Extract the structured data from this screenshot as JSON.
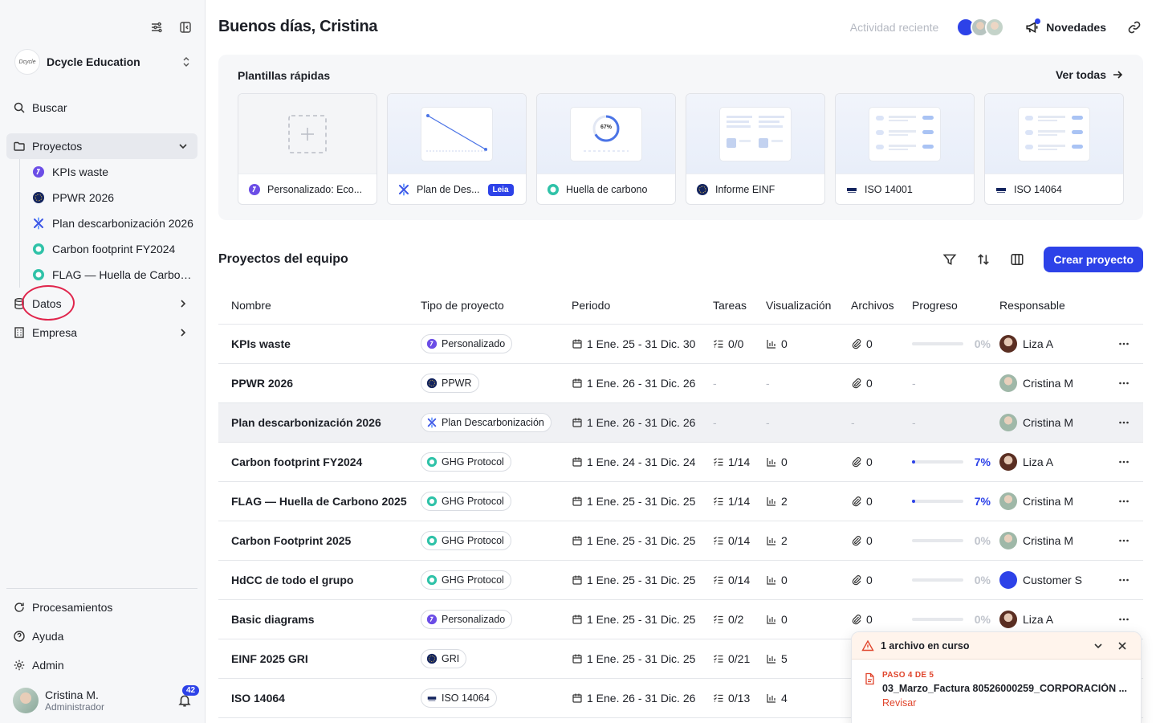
{
  "sidebar": {
    "org_logo_text": "Dcycle",
    "org_name": "Dcycle Education",
    "search_label": "Buscar",
    "projects_label": "Proyectos",
    "project_items": [
      {
        "label": "KPIs waste",
        "icon": "dcycle-icon"
      },
      {
        "label": "PPWR 2026",
        "icon": "eu-icon"
      },
      {
        "label": "Plan descarbonización 2026",
        "icon": "decarb-icon"
      },
      {
        "label": "Carbon footprint FY2024",
        "icon": "ghg-icon"
      },
      {
        "label": "FLAG — Huella de Carbono 2025",
        "icon": "ghg-icon"
      }
    ],
    "data_label": "Datos",
    "company_label": "Empresa",
    "processing_label": "Procesamientos",
    "help_label": "Ayuda",
    "admin_label": "Admin",
    "user_name": "Cristina M.",
    "user_role": "Administrador",
    "notifications_count": "42"
  },
  "header": {
    "greeting": "Buenos días, Cristina",
    "recent_activity": "Actividad reciente",
    "news_label": "Novedades"
  },
  "templates": {
    "title": "Plantillas rápidas",
    "see_all": "Ver todas",
    "items": [
      {
        "label": "Personalizado: Eco...",
        "icon": "dcycle-icon"
      },
      {
        "label": "Plan de Des...",
        "icon": "decarb-icon",
        "badge": "Leia"
      },
      {
        "label": "Huella de carbono",
        "icon": "ghg-icon",
        "preview_value": "67%"
      },
      {
        "label": "Informe EINF",
        "icon": "eu-icon"
      },
      {
        "label": "ISO 14001",
        "icon": "iso-icon"
      },
      {
        "label": "ISO 14064",
        "icon": "iso-icon"
      }
    ]
  },
  "team": {
    "title": "Proyectos del equipo",
    "create_label": "Crear proyecto",
    "columns": [
      "Nombre",
      "Tipo de proyecto",
      "Periodo",
      "Tareas",
      "Visualización",
      "Archivos",
      "Progreso",
      "Responsable"
    ],
    "rows": [
      {
        "name": "KPIs waste",
        "type": "Personalizado",
        "type_icon": "dcycle-icon",
        "period": "1 Ene. 25 - 31 Dic. 30",
        "tasks": "0/0",
        "vis": "0",
        "files": "0",
        "progress": 0,
        "progress_label": "0%",
        "owner": "Liza A",
        "owner_avatar": "liza"
      },
      {
        "name": "PPWR 2026",
        "type": "PPWR",
        "type_icon": "eu-icon",
        "period": "1 Ene. 26 - 31 Dic. 26",
        "tasks": "-",
        "vis": "-",
        "files": "0",
        "progress": null,
        "progress_label": "-",
        "owner": "Cristina M",
        "owner_avatar": "cris"
      },
      {
        "name": "Plan descarbonización 2026",
        "type": "Plan Descarbonización",
        "type_icon": "decarb-icon",
        "period": "1 Ene. 26 - 31 Dic. 26",
        "tasks": "-",
        "vis": "-",
        "files": "-",
        "progress": null,
        "progress_label": "-",
        "owner": "Cristina M",
        "owner_avatar": "cris",
        "highlight": true
      },
      {
        "name": "Carbon footprint FY2024",
        "type": "GHG Protocol",
        "type_icon": "ghg-icon",
        "period": "1 Ene. 24 - 31 Dic. 24",
        "tasks": "1/14",
        "vis": "0",
        "files": "0",
        "progress": 7,
        "progress_label": "7%",
        "owner": "Liza A",
        "owner_avatar": "liza"
      },
      {
        "name": "FLAG — Huella de Carbono 2025",
        "type": "GHG Protocol",
        "type_icon": "ghg-icon",
        "period": "1 Ene. 25 - 31 Dic. 25",
        "tasks": "1/14",
        "vis": "2",
        "files": "0",
        "progress": 7,
        "progress_label": "7%",
        "owner": "Cristina M",
        "owner_avatar": "cris"
      },
      {
        "name": "Carbon Footprint 2025",
        "type": "GHG Protocol",
        "type_icon": "ghg-icon",
        "period": "1 Ene. 25 - 31 Dic. 25",
        "tasks": "0/14",
        "vis": "2",
        "files": "0",
        "progress": 0,
        "progress_label": "0%",
        "owner": "Cristina M",
        "owner_avatar": "cris"
      },
      {
        "name": "HdCC de todo el grupo",
        "type": "GHG Protocol",
        "type_icon": "ghg-icon",
        "period": "1 Ene. 25 - 31 Dic. 25",
        "tasks": "0/14",
        "vis": "0",
        "files": "0",
        "progress": 0,
        "progress_label": "0%",
        "owner": "Customer S",
        "owner_avatar": "cust"
      },
      {
        "name": "Basic diagrams",
        "type": "Personalizado",
        "type_icon": "dcycle-icon",
        "period": "1 Ene. 25 - 31 Dic. 25",
        "tasks": "0/2",
        "vis": "0",
        "files": "0",
        "progress": 0,
        "progress_label": "0%",
        "owner": "Liza A",
        "owner_avatar": "liza"
      },
      {
        "name": "EINF 2025 GRI",
        "type": "GRI",
        "type_icon": "eu-icon",
        "period": "1 Ene. 25 - 31 Dic. 25",
        "tasks": "0/21",
        "vis": "5",
        "files": "",
        "progress": null,
        "progress_label": "",
        "owner": "",
        "owner_avatar": ""
      },
      {
        "name": "ISO 14064",
        "type": "ISO 14064",
        "type_icon": "iso-icon",
        "period": "1 Ene. 26 - 31 Dic. 26",
        "tasks": "0/13",
        "vis": "4",
        "files": "",
        "progress": null,
        "progress_label": "",
        "owner": "",
        "owner_avatar": ""
      }
    ]
  },
  "upload_toast": {
    "title": "1 archivo en curso",
    "step": "PASO 4 DE 5",
    "filename": "03_Marzo_Factura 80526000259_CORPORACIÓN ...",
    "action": "Revisar"
  },
  "colors": {
    "accent": "#2d42e8",
    "warning": "#e0452c",
    "highlight_ring": "#e0254c"
  }
}
